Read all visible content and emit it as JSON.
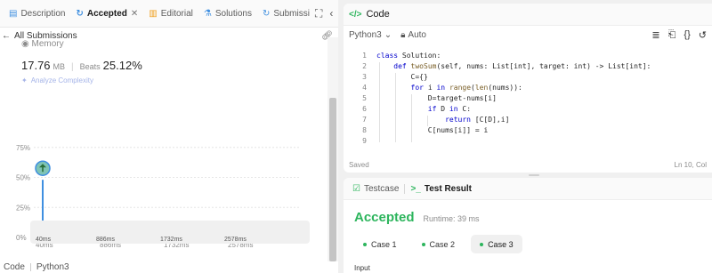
{
  "tabs": [
    {
      "label": "Description",
      "icon": "description-icon"
    },
    {
      "label": "Accepted",
      "icon": "history-icon",
      "active": true,
      "closable": true
    },
    {
      "label": "Editorial",
      "icon": "book-icon"
    },
    {
      "label": "Solutions",
      "icon": "flask-icon"
    },
    {
      "label": "Submissi",
      "icon": "history-icon"
    }
  ],
  "subheader": {
    "back_label": "All Submissions"
  },
  "stats": {
    "section_label": "Memory",
    "value": "17.76",
    "unit": "MB",
    "beats_label": "Beats",
    "beats_value": "25.12%",
    "analyze_label": "Analyze Complexity"
  },
  "chart_data": {
    "type": "bar",
    "ylabel": "",
    "yticks": [
      "75%",
      "50%",
      "25%",
      "0%"
    ],
    "ytick_values": [
      75,
      50,
      25,
      0
    ],
    "xticks": [
      "40ms",
      "886ms",
      "1732ms",
      "2578ms"
    ],
    "xtick_values": [
      40,
      886,
      1732,
      2578
    ],
    "ylim": [
      0,
      80
    ],
    "highlight_bar_index": 0,
    "grid": true,
    "values": [
      48,
      10,
      3,
      3,
      3,
      3,
      3,
      3,
      3,
      3,
      3,
      3,
      3,
      3,
      3,
      3,
      3,
      3,
      3,
      3,
      3,
      3,
      3,
      3,
      3,
      3,
      3,
      3,
      3,
      3,
      3,
      3,
      3,
      3,
      3,
      3,
      3,
      3,
      3,
      3,
      3,
      3,
      3,
      3,
      3,
      3,
      3,
      3,
      3,
      3,
      10,
      7,
      3,
      3,
      3,
      3,
      3,
      3,
      3,
      3,
      5,
      3,
      3,
      3,
      3,
      3,
      3,
      3,
      3,
      3,
      3,
      3,
      3,
      3,
      3,
      3,
      3,
      3,
      3,
      3,
      3,
      3,
      3,
      3,
      3,
      3,
      3,
      3,
      3,
      3,
      3,
      3,
      3,
      3
    ],
    "bar_color": "#3f8fe0"
  },
  "minimap_labels": [
    "40ms",
    "886ms",
    "1732ms",
    "2578ms"
  ],
  "left_footer": {
    "left": "Code",
    "right": "Python3"
  },
  "code_panel": {
    "title": "Code",
    "language": "Python3",
    "auto_label": "Auto",
    "status_left": "Saved",
    "status_right": "Ln 10, Col",
    "lines": [
      {
        "n": "1",
        "text": "class Solution:"
      },
      {
        "n": "2",
        "text": "    def twoSum(self, nums: List[int], target: int) -> List[int]:"
      },
      {
        "n": "3",
        "text": "        C={}"
      },
      {
        "n": "4",
        "text": "        for i in range(len(nums)):"
      },
      {
        "n": "5",
        "text": "            D=target-nums[i]"
      },
      {
        "n": "6",
        "text": "            if D in C:"
      },
      {
        "n": "7",
        "text": "                return [C[D],i]"
      },
      {
        "n": "8",
        "text": "            C[nums[i]] = i"
      },
      {
        "n": "9",
        "text": ""
      }
    ]
  },
  "result_panel": {
    "tab_testcase": "Testcase",
    "tab_result": "Test Result",
    "verdict": "Accepted",
    "runtime": "Runtime: 39 ms",
    "cases": [
      "Case 1",
      "Case 2",
      "Case 3"
    ],
    "selected_case": 2,
    "input_label": "Input"
  },
  "colors": {
    "accent_green": "#2db55d",
    "bar_blue": "#3f8fe0",
    "keyword_blue": "#0000cc"
  }
}
